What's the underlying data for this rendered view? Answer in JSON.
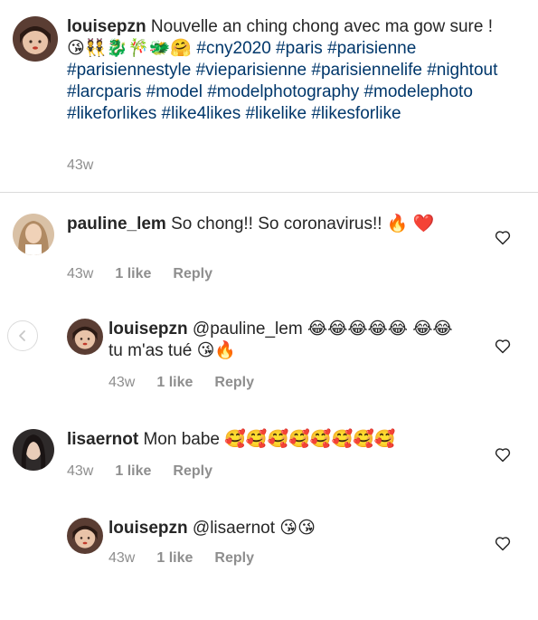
{
  "caption": {
    "username": "louisepzn",
    "text_before_tags": "Nouvelle an ching chong avec ma gow sure ! 😘👯🐉🎋🐲🤗",
    "hashtags": "#cny2020 #paris #parisienne #parisiennestyle #vieparisienne #parisiennelife #nightout #larcparis #model #modelphotography #modelephoto #likeforlikes #like4likes #likelike #likesforlike",
    "time": "43w"
  },
  "comments": [
    {
      "username": "pauline_lem",
      "text": "So chong!! So coronavirus!! 🔥 ❤️",
      "time": "43w",
      "likes": "1 like",
      "reply": "Reply"
    },
    {
      "username": "louisepzn",
      "text": "@pauline_lem 😂😂😂😂😂 😂😂 tu m'as tué 😘🔥",
      "time": "43w",
      "likes": "1 like",
      "reply": "Reply"
    },
    {
      "username": "lisaernot",
      "text": "Mon babe 🥰🥰🥰🥰🥰🥰🥰🥰",
      "time": "43w",
      "likes": "1 like",
      "reply": "Reply"
    },
    {
      "username": "louisepzn",
      "text": "@lisaernot 😘😘",
      "time": "43w",
      "likes": "1 like",
      "reply": "Reply"
    }
  ],
  "icons": {
    "heart": "heart-outline-icon",
    "back": "chevron-left-icon"
  },
  "colors": {
    "hashtag": "#00376b",
    "meta": "#8e8e8e",
    "divider": "#dbdbdb"
  }
}
